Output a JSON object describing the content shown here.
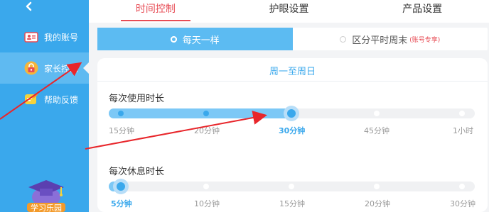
{
  "sidebar": {
    "items": [
      {
        "label": "我的账号",
        "icon": "id-card-icon"
      },
      {
        "label": "家长控制",
        "icon": "lock-icon"
      },
      {
        "label": "帮助反馈",
        "icon": "feedback-icon"
      }
    ],
    "mascot_text": "学习乐园"
  },
  "tabs": [
    {
      "label": "时间控制"
    },
    {
      "label": "护眼设置"
    },
    {
      "label": "产品设置"
    }
  ],
  "mode": {
    "option1": "每天一样",
    "option2": "区分平时周末",
    "option2_badge": "(账号专享)"
  },
  "card": {
    "title": "周一至周日",
    "usage": {
      "label": "每次使用时长",
      "ticks": [
        "15分钟",
        "20分钟",
        "30分钟",
        "45分钟",
        "1小时"
      ],
      "selected": "30分钟"
    },
    "rest": {
      "label": "每次休息时长",
      "ticks": [
        "5分钟",
        "10分钟",
        "15分钟",
        "20分钟",
        "30分钟"
      ],
      "selected": "5分钟"
    }
  },
  "colors": {
    "sidebar_bg": "#3aa8ec",
    "accent_red": "#e74c55",
    "slider_fill": "#7cc8f6",
    "slider_thumb": "#3aa8ec"
  }
}
